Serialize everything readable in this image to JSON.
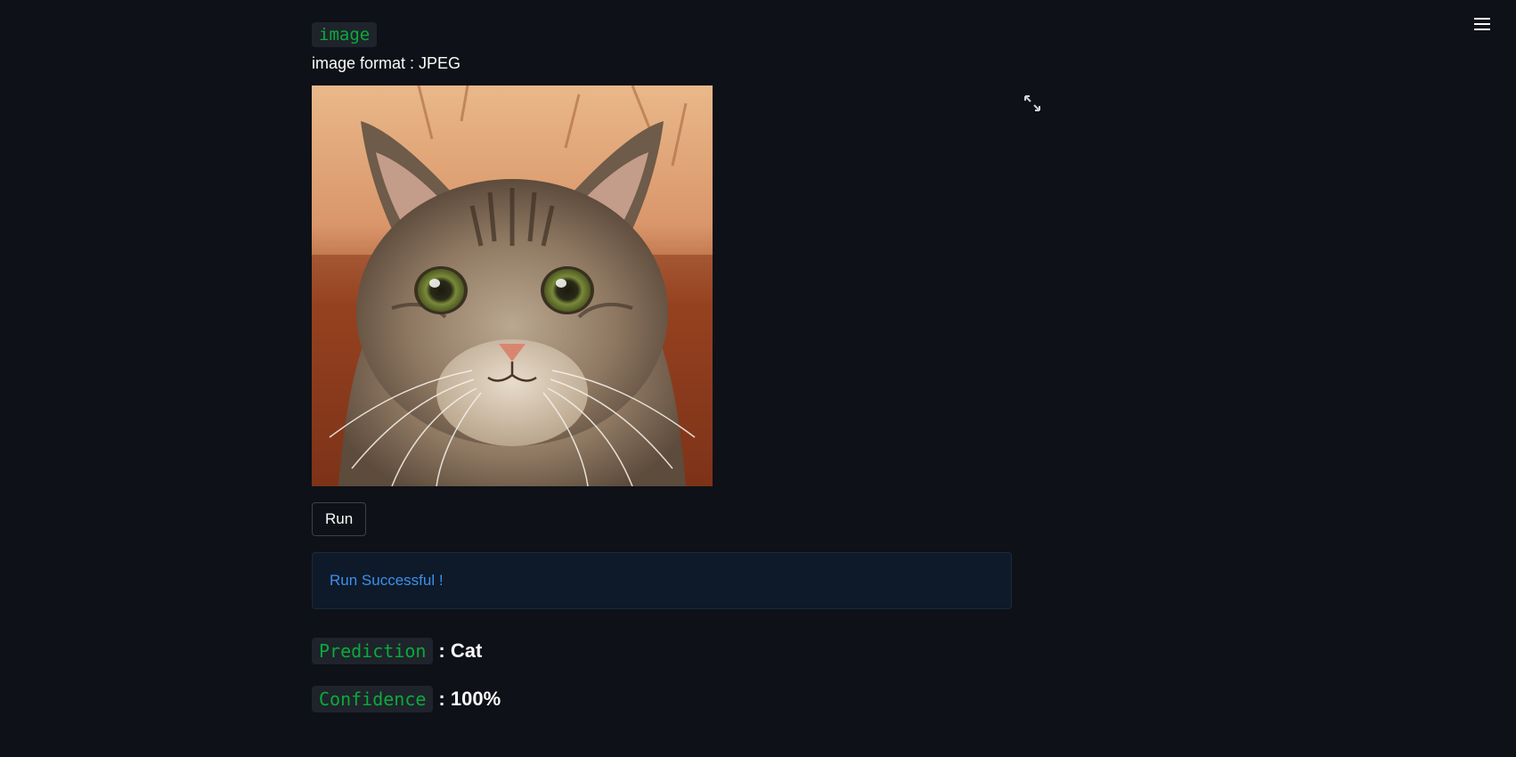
{
  "header": {
    "menu_icon": "hamburger-menu-icon"
  },
  "main": {
    "image_tag": "image",
    "format_label": "image format : JPEG",
    "fullscreen_icon": "expand-icon",
    "run_button_label": "Run",
    "alert": {
      "text": "Run Successful !",
      "color": "#3d8fec"
    },
    "prediction": {
      "label": "Prediction",
      "value": ": Cat"
    },
    "confidence": {
      "label": "Confidence",
      "value": ": 100%"
    }
  },
  "colors": {
    "background": "#0e1117",
    "code_text": "#09ab3b",
    "code_background": "#1f232b",
    "alert_background": "#0e1a29"
  }
}
